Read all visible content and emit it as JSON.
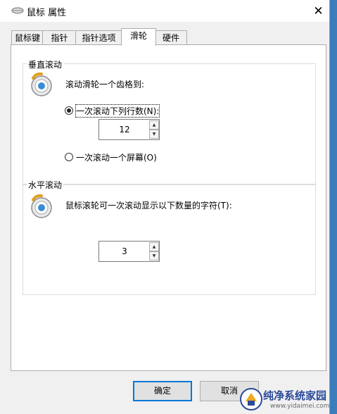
{
  "window": {
    "title": "鼠标 属性",
    "close_label": "✕"
  },
  "tabs": [
    {
      "label": "鼠标键"
    },
    {
      "label": "指针"
    },
    {
      "label": "指针选项"
    },
    {
      "label": "滑轮",
      "active": true
    },
    {
      "label": "硬件"
    }
  ],
  "vertical": {
    "title": "垂直滚动",
    "description": "滚动滑轮一个齿格到:",
    "option_lines": "一次滚动下列行数(N):",
    "option_screen": "一次滚动一个屏幕(O)",
    "selected": "option_lines",
    "lines_value": "12"
  },
  "horizontal": {
    "title": "水平滚动",
    "description": "鼠标滚轮可一次滚动显示以下数量的字符(T):",
    "chars_value": "3"
  },
  "buttons": {
    "ok": "确定",
    "cancel": "取消"
  },
  "watermark": {
    "text": "纯净系统家园",
    "url": "www.yidaimei.com"
  },
  "icons": {
    "title": "mouse-icon",
    "wheel": "mouse-wheel-icon",
    "close": "close-icon",
    "up": "chevron-up-icon",
    "down": "chevron-down-icon"
  },
  "colors": {
    "accent": "#0078d7",
    "panel": "#ffffff",
    "dialog": "#f0f0f0"
  }
}
